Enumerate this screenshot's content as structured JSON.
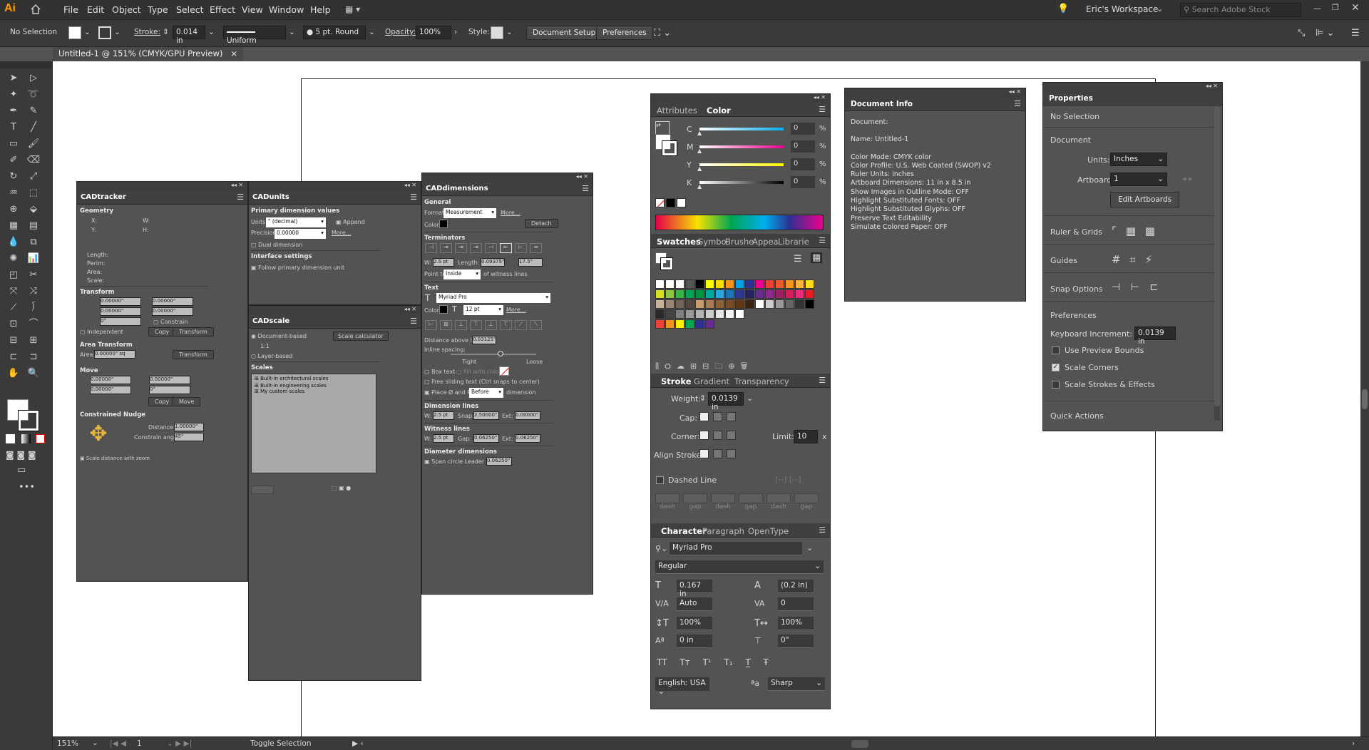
{
  "app": {
    "logo": "Ai",
    "workspace": "Eric's Workspace",
    "search_placeholder": "Search Adobe Stock"
  },
  "menu": [
    "File",
    "Edit",
    "Object",
    "Type",
    "Select",
    "Effect",
    "View",
    "Window",
    "Help"
  ],
  "control": {
    "selection": "No Selection",
    "stroke_label": "Stroke:",
    "stroke_value": "0.014 in",
    "profile": "Uniform",
    "brush": "5 pt. Round",
    "opacity_label": "Opacity:",
    "opacity_value": "100%",
    "style_label": "Style:",
    "doc_setup": "Document Setup",
    "preferences": "Preferences"
  },
  "document_tab": {
    "title": "Untitled-1 @ 151% (CMYK/GPU Preview)",
    "close": "×"
  },
  "status": {
    "zoom": "151%",
    "page": "1",
    "tool": "Toggle Selection"
  },
  "cadtracker": {
    "title": "CADtracker",
    "geometry": "Geometry",
    "x": "X:",
    "y": "Y:",
    "w": "W:",
    "h": "H:",
    "length": "Length:",
    "perim": "Perim:",
    "area": "Area:",
    "scale": "Scale:",
    "transform": "Transform",
    "tx": "0.00000\"",
    "ty": "0.00000\"",
    "tw": "0.00000\"",
    "th": "0.00000\"",
    "angle": "0°",
    "constrain": "Constrain",
    "independent": "Independent",
    "copy": "Copy",
    "transform_btn": "Transform",
    "area_transform": "Area Transform",
    "area_label": "Area:",
    "area_val": "0.00000\" sq",
    "move": "Move",
    "dx": "0.00000\"",
    "dy": "0.00000\"",
    "dist": "0.00000\"",
    "mangle": "0°",
    "move_btn": "Move",
    "nudge": "Constrained Nudge",
    "distance_label": "Distance:",
    "distance_val": "1.00000\"",
    "cangle_label": "Constrain angle:",
    "cangle_val": "45°",
    "scale_zoom": "Scale distance with zoom"
  },
  "cadunits": {
    "title": "CADunits",
    "primary": "Primary dimension values",
    "units_label": "Units:",
    "units_val": "\" (decimal)",
    "append": "Append",
    "precision_label": "Precision:",
    "precision_val": "0.00000",
    "more": "More...",
    "dual": "Dual dimension",
    "interface": "Interface settings",
    "follow": "Follow primary dimension unit"
  },
  "cadscale": {
    "title": "CADscale",
    "doc_based": "Document-based",
    "calc": "Scale calculator",
    "ratio": "1:1",
    "layer_based": "Layer-based",
    "scales": "Scales",
    "items": [
      "Built-in architectural scales",
      "Built-in engineering scales",
      "My custom scales"
    ]
  },
  "caddimensions": {
    "title": "CADdimensions",
    "general": "General",
    "format_label": "Format:",
    "format_val": "Measurement",
    "more": "More...",
    "color_label": "Color:",
    "detach": "Detach",
    "terminators": "Terminators",
    "w_label": "W:",
    "w_val": "2.5 pt",
    "len_label": "Length:",
    "len_val": "0.09375\"",
    "ang_val": "17.5°",
    "point_label": "Point to",
    "point_val": "Inside",
    "point_suffix": "of witness lines",
    "text": "Text",
    "font": "Myriad Pro",
    "size": "12 pt",
    "dist_above": "Distance above line:",
    "dist_above_val": "0.03125\"",
    "inline": "Inline spacing:",
    "tight": "Tight",
    "loose": "Loose",
    "box_text": "Box text",
    "fill_color": "Fill with color",
    "free_slide": "Free sliding text (Ctrl snaps to center)",
    "place": "Place Ø and R:",
    "place_val": "Before",
    "place_suffix": "dimension",
    "dimlines": "Dimension lines",
    "snap_label": "Snap:",
    "snap_val": "2.50000\"",
    "ext_label": "Ext:",
    "ext_val": "0.00000\"",
    "witness": "Witness lines",
    "gap_label": "Gap:",
    "gap_val": "0.06250\"",
    "wext_val": "0.06250\"",
    "diameter": "Diameter dimensions",
    "span": "Span circle Leader ext:",
    "span_val": "0.06250\""
  },
  "color_panel": {
    "tabs": [
      "Attributes",
      "Color"
    ],
    "rows": [
      {
        "l": "C",
        "v": "0"
      },
      {
        "l": "M",
        "v": "0"
      },
      {
        "l": "Y",
        "v": "0"
      },
      {
        "l": "K",
        "v": "0"
      }
    ],
    "pct": "%"
  },
  "swatches": {
    "tabs": [
      "Swatches",
      "Symbo",
      "Brushe",
      "Appea",
      "Librarie"
    ]
  },
  "stroke": {
    "tabs": [
      "Stroke",
      "Gradient",
      "Transparency"
    ],
    "weight_label": "Weight:",
    "weight": "0.0139 in",
    "cap": "Cap:",
    "corner": "Corner:",
    "limit_label": "Limit:",
    "limit": "10",
    "limit_x": "x",
    "align": "Align Stroke:",
    "dashed": "Dashed Line",
    "dash_labels": [
      "dash",
      "gap",
      "dash",
      "gap",
      "dash",
      "gap"
    ]
  },
  "character": {
    "tabs": [
      "Character",
      "Paragraph",
      "OpenType"
    ],
    "font": "Myriad Pro",
    "style": "Regular",
    "size": "0.167 in",
    "leading": "(0.2 in)",
    "kerning": "Auto",
    "tracking": "0",
    "vscale": "100%",
    "hscale": "100%",
    "baseline": "0 in",
    "rotation": "0°",
    "language": "English: USA",
    "aa": "Sharp"
  },
  "doc_info": {
    "title": "Document Info",
    "lines": [
      "Document:",
      "",
      "Name: Untitled-1",
      "",
      "Color Mode: CMYK color",
      "Color Profile: U.S. Web Coated (SWOP) v2",
      "Ruler Units: inches",
      "Artboard Dimensions: 11 in x 8.5 in",
      "Show Images in Outline Mode: OFF",
      "Highlight Substituted Fonts: OFF",
      "Highlight Substituted Glyphs: OFF",
      "Preserve Text Editability",
      "Simulate Colored Paper: OFF"
    ]
  },
  "properties": {
    "title": "Properties",
    "no_sel": "No Selection",
    "document": "Document",
    "units_label": "Units:",
    "units": "Inches",
    "artboard_label": "Artboard:",
    "artboard": "1",
    "edit_artboards": "Edit Artboards",
    "rulers": "Ruler & Grids",
    "guides": "Guides",
    "snap": "Snap Options",
    "prefs": "Preferences",
    "kbd_label": "Keyboard Increment:",
    "kbd": "0.0139 in",
    "preview_bounds": "Use Preview Bounds",
    "scale_corners": "Scale Corners",
    "scale_strokes": "Scale Strokes & Effects",
    "quick": "Quick Actions"
  }
}
